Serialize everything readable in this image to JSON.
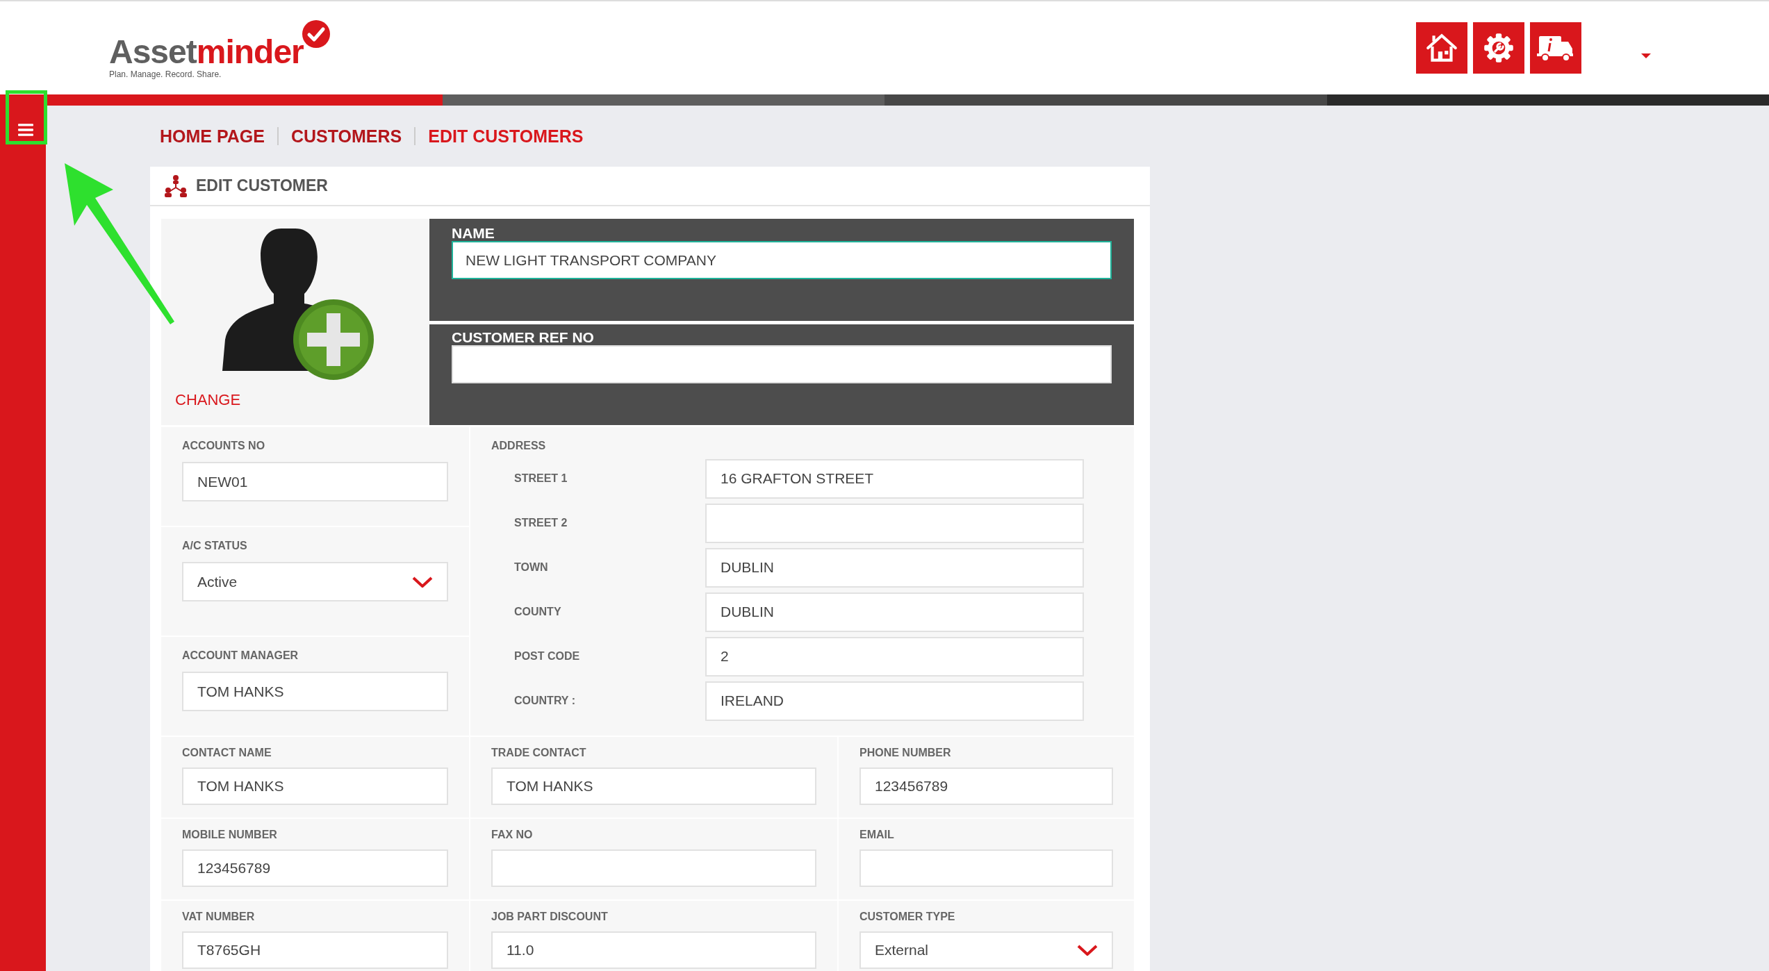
{
  "header": {
    "logo": {
      "part_1": "Asset",
      "part_2": "minder",
      "tagline": "Plan. Manage. Record. Share."
    }
  },
  "breadcrumb": [
    {
      "label": "HOME PAGE"
    },
    {
      "label": "CUSTOMERS"
    },
    {
      "label": "EDIT CUSTOMERS"
    }
  ],
  "card": {
    "title": "EDIT CUSTOMER",
    "photo_link": "CHANGE",
    "name": {
      "label": "NAME",
      "value": "NEW LIGHT TRANSPORT COMPANY",
      "focused": true
    },
    "ref": {
      "label": "CUSTOMER REF NO",
      "focused": false
    },
    "left_fields": [
      {
        "label": "ACCOUNTS NO",
        "value": "NEW01",
        "kind": "text"
      },
      {
        "label": "A/C STATUS",
        "value": "Active",
        "kind": "select"
      },
      {
        "label": "ACCOUNT MANAGER",
        "value": "TOM HANKS",
        "kind": "text"
      }
    ],
    "address": {
      "label": "ADDRESS",
      "rows": [
        {
          "label": "STREET 1",
          "value": "16 GRAFTON STREET"
        },
        {
          "label": "STREET 2"
        },
        {
          "label": "TOWN",
          "value": "DUBLIN"
        },
        {
          "label": "COUNTY",
          "value": "DUBLIN"
        },
        {
          "label": "POST CODE",
          "value": "2"
        },
        {
          "label": "COUNTRY :",
          "value": "IRELAND"
        }
      ]
    },
    "grid_rows": [
      [
        {
          "label": "CONTACT NAME",
          "value": "TOM HANKS",
          "kind": "text"
        },
        {
          "label": "TRADE CONTACT",
          "value": "TOM HANKS",
          "kind": "text"
        },
        {
          "label": "PHONE NUMBER",
          "value": "123456789",
          "kind": "text"
        }
      ],
      [
        {
          "label": "MOBILE NUMBER",
          "value": "123456789",
          "kind": "text"
        },
        {
          "label": "FAX NO",
          "kind": "text"
        },
        {
          "label": "EMAIL",
          "kind": "text"
        }
      ],
      [
        {
          "label": "VAT NUMBER",
          "value": "T8765GH",
          "kind": "text"
        },
        {
          "label": "JOB PART DISCOUNT",
          "value": "11.0",
          "kind": "text"
        },
        {
          "label": "CUSTOMER TYPE",
          "value": "External",
          "kind": "select"
        }
      ]
    ]
  }
}
